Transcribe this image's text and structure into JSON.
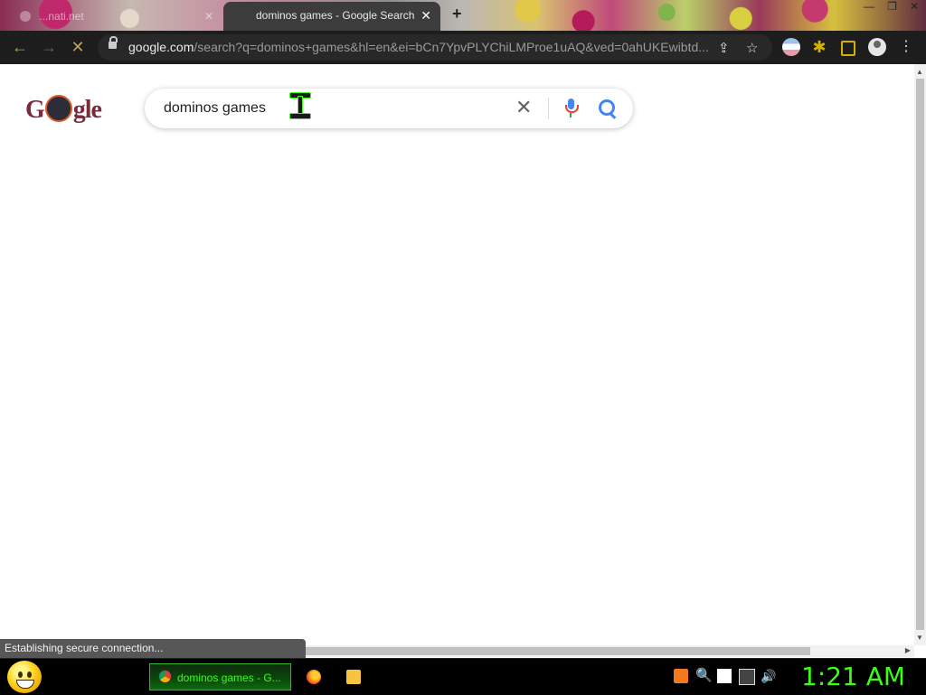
{
  "tabs": {
    "inactive_label": "...nati.net",
    "active_label": "dominos games - Google Search",
    "close_glyph": "✕",
    "new_tab_glyph": "+"
  },
  "window_controls": {
    "minimize": "—",
    "maximize": "❐",
    "close": "✕"
  },
  "toolbar": {
    "back_glyph": "←",
    "forward_glyph": "→",
    "stop_glyph": "✕",
    "url_host": "google.com",
    "url_rest": "/search?q=dominos+games&hl=en&ei=bCn7YpvPLYChiLMProe1uAQ&ved=0ahUKEwibtd...",
    "share_glyph": "⇪",
    "bookmark_glyph": "☆",
    "kebab_glyph": "⋮"
  },
  "page": {
    "logo_text_left": "G",
    "logo_text_right": "gle",
    "search_query": "dominos games",
    "clear_glyph": "✕"
  },
  "status_bar": {
    "text": "Establishing secure connection..."
  },
  "taskbar": {
    "task_label": "dominos games - G...",
    "clock": "1:21 AM",
    "volume_glyph": "🔊",
    "search_glyph": "🔍"
  },
  "colors": {
    "accent_green": "#39ff14",
    "toolbar_bg": "#1d1d1d",
    "extension_gold": "#d6b000",
    "logo_maroon": "#7b2a3b"
  },
  "icons": [
    "back-arrow-icon",
    "forward-arrow-icon",
    "stop-loading-icon",
    "lock-icon",
    "share-icon",
    "bookmark-star-icon",
    "flag-extension-icon",
    "puzzle-extensions-icon",
    "side-panel-icon",
    "profile-avatar-icon",
    "more-menu-icon",
    "clear-search-icon",
    "mic-icon",
    "search-lens-icon",
    "smiley-start-icon",
    "chrome-icon",
    "firefox-icon",
    "folder-icon",
    "xampp-icon",
    "search-tray-icon",
    "action-center-flag-icon",
    "network-icon",
    "volume-icon"
  ]
}
